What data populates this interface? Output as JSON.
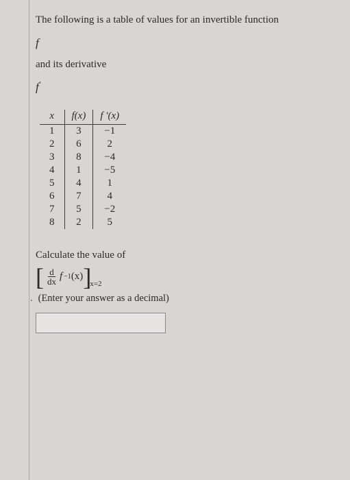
{
  "intro": "The following is a table of values for an invertible function",
  "fn_symbol": "f",
  "deriv_text": "and its derivative",
  "deriv_symbol_base": "f",
  "deriv_symbol_prime": "′",
  "headers": {
    "x": "x",
    "fx": "f(x)",
    "fpx": "f ′(x)"
  },
  "rows": [
    {
      "x": "1",
      "fx": "3",
      "fpx": "−1"
    },
    {
      "x": "2",
      "fx": "6",
      "fpx": "2"
    },
    {
      "x": "3",
      "fx": "8",
      "fpx": "−4"
    },
    {
      "x": "4",
      "fx": "1",
      "fpx": "−5"
    },
    {
      "x": "5",
      "fx": "4",
      "fpx": "1"
    },
    {
      "x": "6",
      "fx": "7",
      "fpx": "4"
    },
    {
      "x": "7",
      "fx": "5",
      "fpx": "−2"
    },
    {
      "x": "8",
      "fx": "2",
      "fpx": "5"
    }
  ],
  "calc_text": "Calculate the value of",
  "expr": {
    "d": "d",
    "dx": "dx",
    "f": "f",
    "inv": "−1",
    "arg": "(x)",
    "eval": "x=2"
  },
  "hint": "(Enter your answer as a decimal)",
  "answer_value": ""
}
